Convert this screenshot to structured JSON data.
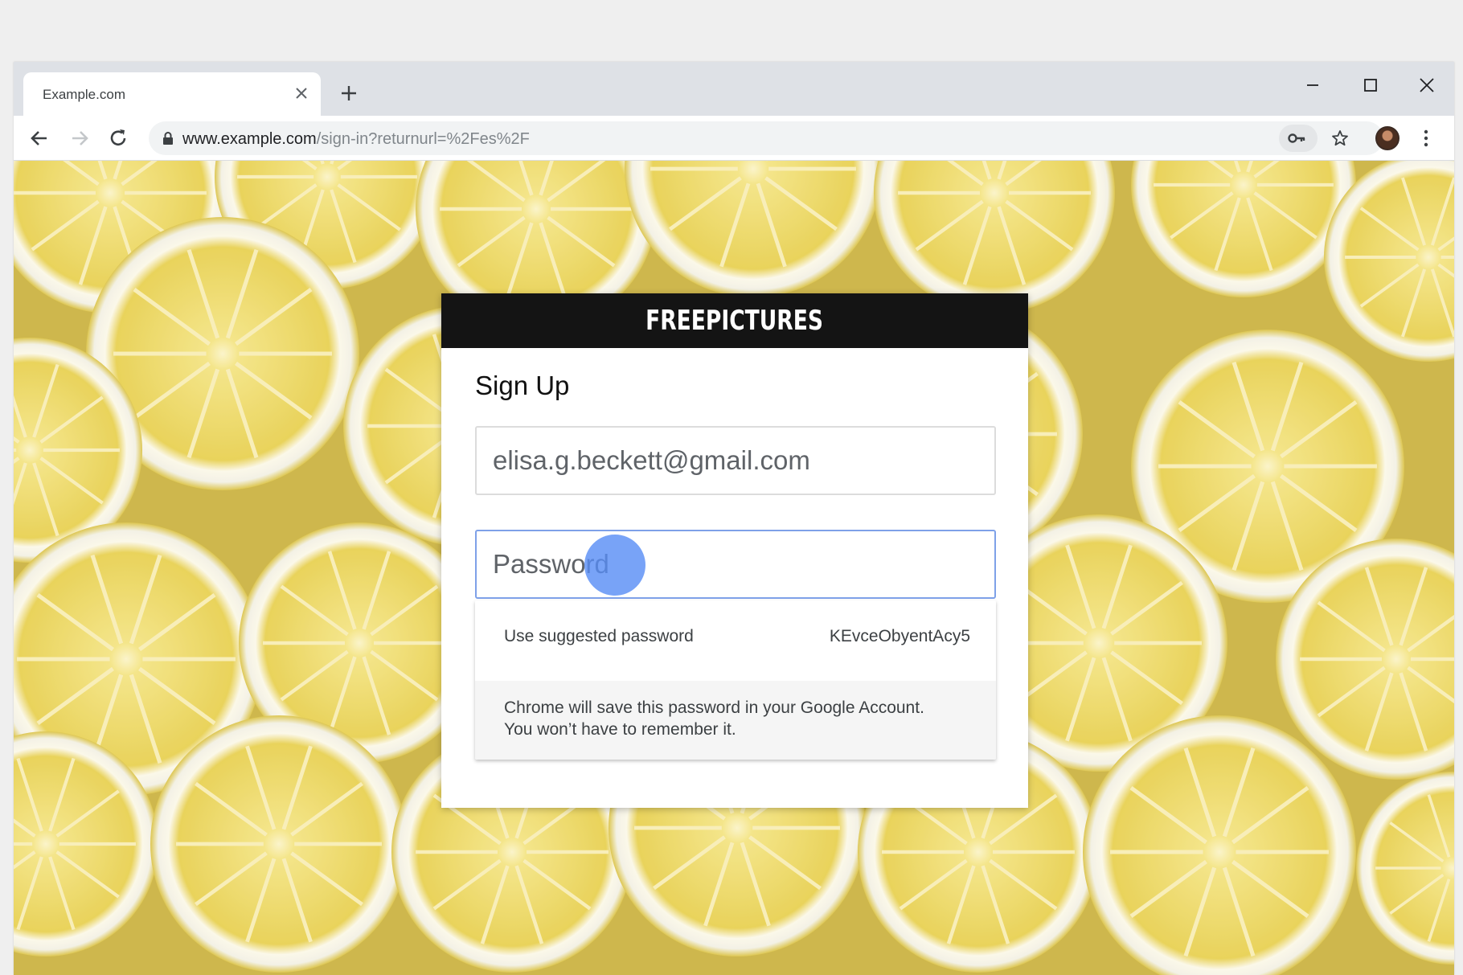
{
  "browser": {
    "tab_title": "Example.com",
    "url_host": "www.example.com",
    "url_path": "/sign-in?returnurl=%2Fes%2F"
  },
  "page": {
    "brand": "FREEPICTURES",
    "form_title": "Sign Up",
    "email_value": "elisa.g.beckett@gmail.com",
    "password_placeholder": "Password"
  },
  "password_suggestion": {
    "label": "Use suggested password",
    "value": "KEvceObyentAcy5",
    "note_line1": "Chrome will save this password in your Google Account.",
    "note_line2": "You won’t have to remember it."
  },
  "icons": {
    "tab_close": "close-icon",
    "new_tab": "plus-icon",
    "back": "arrow-left-icon",
    "forward": "arrow-right-icon",
    "reload": "reload-icon",
    "lock": "lock-icon",
    "key": "key-icon",
    "star": "star-icon",
    "menu": "vertical-dots-icon"
  },
  "colors": {
    "header_bg": "#141414",
    "focus_border": "#7ea1e8",
    "cursor": "#568cf5",
    "lemon_yellow": "#e9d24f"
  }
}
